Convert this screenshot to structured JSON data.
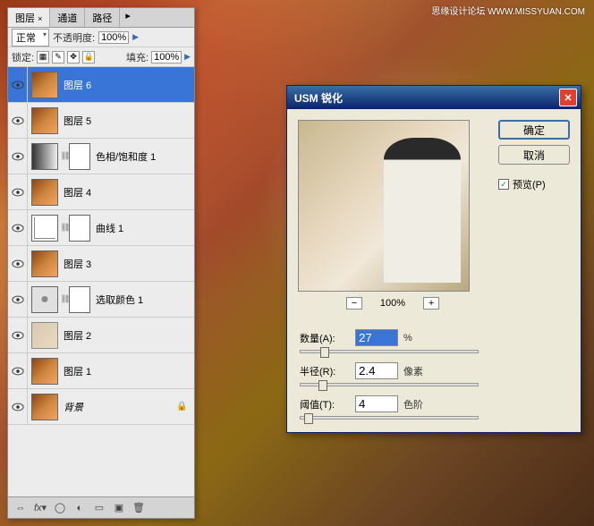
{
  "watermark": "思缘设计论坛 WWW.MISSYUAN.COM",
  "layers_panel": {
    "tabs": {
      "layers": "图层",
      "channels": "通道",
      "paths": "路径"
    },
    "blend_mode": "正常",
    "opacity_label": "不透明度:",
    "opacity_value": "100%",
    "lock_label": "锁定:",
    "fill_label": "填充:",
    "fill_value": "100%",
    "layers": [
      {
        "name": "图层 6",
        "selected": true,
        "type": "image"
      },
      {
        "name": "图层 5",
        "type": "image"
      },
      {
        "name": "色相/饱和度 1",
        "type": "adjust-gray",
        "mask": true
      },
      {
        "name": "图层 4",
        "type": "image"
      },
      {
        "name": "曲线 1",
        "type": "adjust-curve",
        "mask": true
      },
      {
        "name": "图层 3",
        "type": "image"
      },
      {
        "name": "选取颜色 1",
        "type": "adjust-sel",
        "mask": true
      },
      {
        "name": "图层 2",
        "type": "image-faded"
      },
      {
        "name": "图层 1",
        "type": "image"
      },
      {
        "name": "背景",
        "type": "image",
        "locked": true,
        "italic": true
      }
    ]
  },
  "dialog": {
    "title": "USM 锐化",
    "ok": "确定",
    "cancel": "取消",
    "preview": "预览(P)",
    "zoom": "100%",
    "amount_label": "数量(A):",
    "amount_value": "27",
    "amount_unit": "%",
    "radius_label": "半径(R):",
    "radius_value": "2.4",
    "radius_unit": "像素",
    "threshold_label": "阈值(T):",
    "threshold_value": "4",
    "threshold_unit": "色阶"
  }
}
